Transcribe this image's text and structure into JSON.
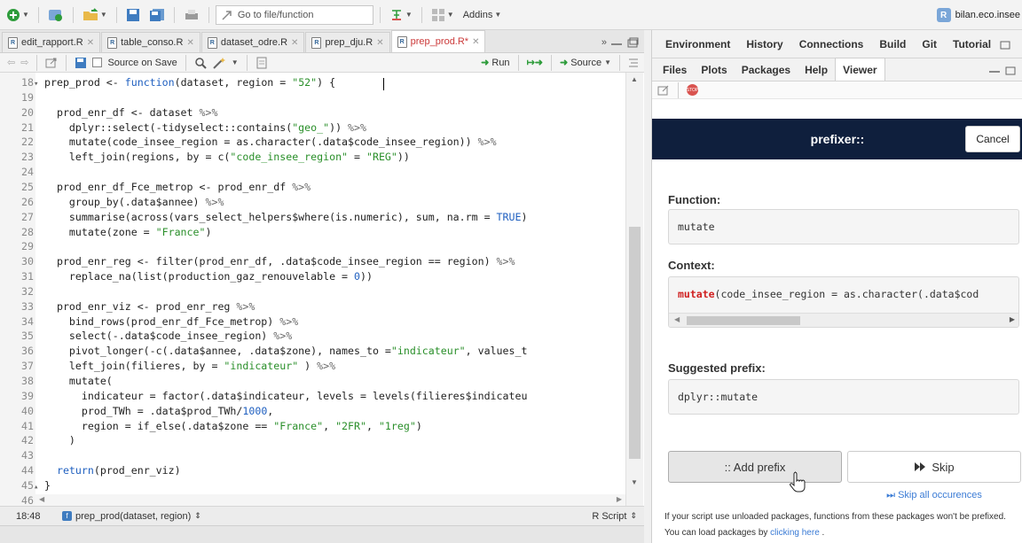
{
  "toolbar": {
    "goto_placeholder": "Go to file/function",
    "addins_label": "Addins",
    "project_label": "bilan.eco.insee"
  },
  "editor": {
    "tabs": [
      {
        "label": "edit_rapport.R",
        "active": false
      },
      {
        "label": "table_conso.R",
        "active": false
      },
      {
        "label": "dataset_odre.R",
        "active": false
      },
      {
        "label": "prep_dju.R",
        "active": false
      },
      {
        "label": "prep_prod.R*",
        "active": true
      }
    ],
    "more_tabs": "»",
    "source_on_save_label": "Source on Save",
    "run_label": "Run",
    "source_label": "Source",
    "lines": [
      {
        "n": "18",
        "fold": "▾",
        "code": "prep_prod <- function(dataset, region = \"52\") {"
      },
      {
        "n": "19",
        "fold": "",
        "code": ""
      },
      {
        "n": "20",
        "fold": "",
        "code": "  prod_enr_df <- dataset %>%"
      },
      {
        "n": "21",
        "fold": "",
        "code": "    dplyr::select(-tidyselect::contains(\"geo_\")) %>%"
      },
      {
        "n": "22",
        "fold": "",
        "code": "    mutate(code_insee_region = as.character(.data$code_insee_region)) %>%"
      },
      {
        "n": "23",
        "fold": "",
        "code": "    left_join(regions, by = c(\"code_insee_region\" = \"REG\"))"
      },
      {
        "n": "24",
        "fold": "",
        "code": ""
      },
      {
        "n": "25",
        "fold": "",
        "code": "  prod_enr_df_Fce_metrop <- prod_enr_df %>%"
      },
      {
        "n": "26",
        "fold": "",
        "code": "    group_by(.data$annee) %>%"
      },
      {
        "n": "27",
        "fold": "",
        "code": "    summarise(across(vars_select_helpers$where(is.numeric), sum, na.rm = TRUE)"
      },
      {
        "n": "28",
        "fold": "",
        "code": "    mutate(zone = \"France\")"
      },
      {
        "n": "29",
        "fold": "",
        "code": ""
      },
      {
        "n": "30",
        "fold": "",
        "code": "  prod_enr_reg <- filter(prod_enr_df, .data$code_insee_region == region) %>%"
      },
      {
        "n": "31",
        "fold": "",
        "code": "    replace_na(list(production_gaz_renouvelable = 0))"
      },
      {
        "n": "32",
        "fold": "",
        "code": ""
      },
      {
        "n": "33",
        "fold": "",
        "code": "  prod_enr_viz <- prod_enr_reg %>%"
      },
      {
        "n": "34",
        "fold": "",
        "code": "    bind_rows(prod_enr_df_Fce_metrop) %>%"
      },
      {
        "n": "35",
        "fold": "",
        "code": "    select(-.data$code_insee_region) %>%"
      },
      {
        "n": "36",
        "fold": "",
        "code": "    pivot_longer(-c(.data$annee, .data$zone), names_to =\"indicateur\", values_t"
      },
      {
        "n": "37",
        "fold": "",
        "code": "    left_join(filieres, by = \"indicateur\" ) %>%"
      },
      {
        "n": "38",
        "fold": "",
        "code": "    mutate("
      },
      {
        "n": "39",
        "fold": "",
        "code": "      indicateur = factor(.data$indicateur, levels = levels(filieres$indicateu"
      },
      {
        "n": "40",
        "fold": "",
        "code": "      prod_TWh = .data$prod_TWh/1000,"
      },
      {
        "n": "41",
        "fold": "",
        "code": "      region = if_else(.data$zone == \"France\", \"2FR\", \"1reg\")"
      },
      {
        "n": "42",
        "fold": "",
        "code": "    )"
      },
      {
        "n": "43",
        "fold": "",
        "code": ""
      },
      {
        "n": "44",
        "fold": "",
        "code": "  return(prod_enr_viz)"
      },
      {
        "n": "45",
        "fold": "▴",
        "code": "}"
      },
      {
        "n": "46",
        "fold": "",
        "code": ""
      }
    ],
    "status": {
      "position": "18:48",
      "function_scope": "prep_prod(dataset, region)",
      "file_type": "R Script"
    }
  },
  "right_pane": {
    "top_tabs": [
      "Environment",
      "History",
      "Connections",
      "Build",
      "Git",
      "Tutorial"
    ],
    "viewer_tabs": [
      "Files",
      "Plots",
      "Packages",
      "Help",
      "Viewer"
    ],
    "active_viewer_tab": "Viewer"
  },
  "addin": {
    "title": "prefixer::",
    "cancel_label": "Cancel",
    "function_label": "Function:",
    "function_value": "mutate",
    "context_label": "Context:",
    "context_highlight": "mutate",
    "context_rest": "(code_insee_region = as.character(.data$cod",
    "suggested_label": "Suggested prefix:",
    "suggested_value": "dplyr::mutate",
    "add_prefix_label": ":: Add prefix",
    "skip_label": "Skip",
    "skip_all_label": "Skip all occurences",
    "note_text": "If your script use unloaded packages, functions from these packages won't be prefixed. You can load packages by ",
    "note_link": "clicking here",
    "note_end": " ."
  },
  "colors": {
    "addin_header_bg": "#0f1f3d",
    "active_tab_text": "#cc3a3a",
    "link": "#3a7bd5",
    "keyword": "#2060c0",
    "string": "#2a8f2a"
  }
}
